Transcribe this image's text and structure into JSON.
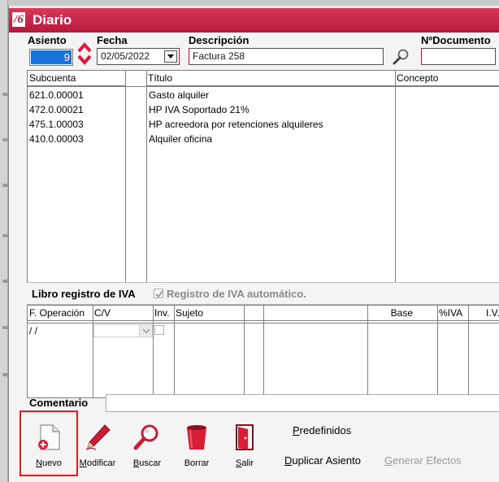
{
  "window": {
    "title": "Diario",
    "logo": "/6",
    "accent": "#c8254a"
  },
  "header": {
    "asiento_label": "Asiento",
    "asiento_value": "9",
    "fecha_label": "Fecha",
    "fecha_value": "02/05/2022",
    "descripcion_label": "Descripción",
    "descripcion_value": "Factura 258",
    "ndocumento_label": "NºDocumento",
    "ndocumento_value": ""
  },
  "entries": {
    "columns": [
      "Subcuenta",
      "Título",
      "Concepto"
    ],
    "rows": [
      {
        "subcuenta": "621.0.00001",
        "titulo": "Gasto alquiler"
      },
      {
        "subcuenta": "472.0.00021",
        "titulo": "HP IVA Soportado 21%"
      },
      {
        "subcuenta": "475.1.00003",
        "titulo": "HP acreedora por retenciones alquileres"
      },
      {
        "subcuenta": "410.0.00003",
        "titulo": "Alquiler oficina"
      }
    ]
  },
  "iva": {
    "section_label": "Libro registro de IVA",
    "auto_label": "Registro de IVA automático.",
    "auto_checked": true,
    "columns": [
      "F. Operación",
      "C/V",
      "Inv.",
      "Sujeto",
      "Base",
      "%IVA",
      "I.V."
    ],
    "row": {
      "f_operacion": "/  /"
    }
  },
  "comentario": {
    "label": "Comentario",
    "value": ""
  },
  "toolbar": {
    "nuevo_mnemonic": "N",
    "nuevo_rest": "uevo",
    "modificar_mnemonic": "M",
    "modificar_rest": "odificar",
    "buscar_mnemonic": "B",
    "buscar_rest": "uscar",
    "borrar": "Borrar",
    "salir_mnemonic": "S",
    "salir_rest": "alir",
    "predefinidos_mnemonic": "P",
    "predefinidos_rest": "redefinidos",
    "duplicar_mnemonic": "D",
    "duplicar_rest": "uplicar Asiento",
    "generar_mnemonic": "G",
    "generar_rest": "enerar Efectos"
  }
}
